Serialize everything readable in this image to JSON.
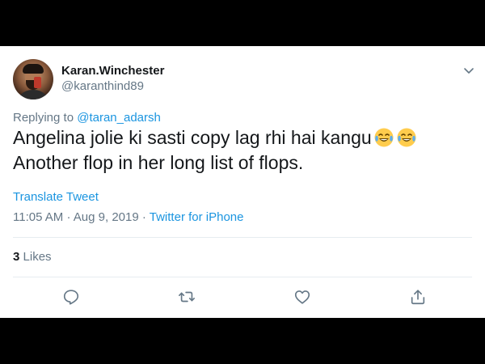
{
  "tweet": {
    "display_name": "Karan.Winchester",
    "handle": "@karanthind89",
    "replying_prefix": "Replying to",
    "replying_to": "@taran_adarsh",
    "text_line1": "Angelina jolie ki sasti copy lag rhi hai kangu",
    "text_line2": "Another flop in her long list of flops.",
    "emoji": [
      "face-with-tears-of-joy",
      "face-with-tears-of-joy"
    ],
    "translate_label": "Translate Tweet",
    "time": "11:05 AM",
    "date": "Aug 9, 2019",
    "separator": "·",
    "source": "Twitter for iPhone",
    "likes_count": "3",
    "likes_label": "Likes"
  },
  "actions": [
    {
      "name": "reply",
      "icon": "reply-icon"
    },
    {
      "name": "retweet",
      "icon": "retweet-icon"
    },
    {
      "name": "like",
      "icon": "heart-icon"
    },
    {
      "name": "share",
      "icon": "share-icon"
    }
  ],
  "colors": {
    "link": "#1b95e0",
    "secondary_text": "#657786",
    "primary_text": "#14171a",
    "letterbox": "#000000"
  }
}
